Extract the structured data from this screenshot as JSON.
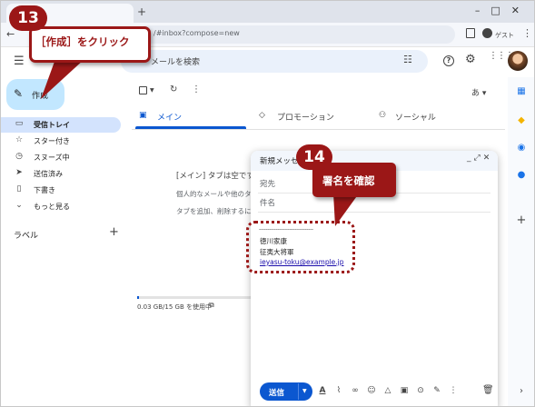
{
  "browser": {
    "tab_title": "",
    "url": "/#inbox?compose=new",
    "profile_label": "ゲスト"
  },
  "gmail": {
    "search_placeholder": "メールを検索",
    "compose_label": "作成",
    "sidebar": {
      "items": [
        {
          "label": "受信トレイ",
          "icon": "inbox-icon",
          "active": true
        },
        {
          "label": "スター付き",
          "icon": "star-icon",
          "active": false
        },
        {
          "label": "スヌーズ中",
          "icon": "clock-icon",
          "active": false
        },
        {
          "label": "送信済み",
          "icon": "send-icon",
          "active": false
        },
        {
          "label": "下書き",
          "icon": "draft-icon",
          "active": false
        },
        {
          "label": "もっと見る",
          "icon": "chevron-down-icon",
          "active": false
        }
      ],
      "labels_heading": "ラベル"
    },
    "toolbar": {
      "input_mode": "あ"
    },
    "tabs": [
      {
        "label": "メイン",
        "icon": "inbox-icon",
        "selected": true
      },
      {
        "label": "プロモーション",
        "icon": "tag-icon",
        "selected": false
      },
      {
        "label": "ソーシャル",
        "icon": "people-icon",
        "selected": false
      }
    ],
    "empty_state": {
      "line1": "[メイン] タブは空です",
      "line2": "個人的なメールや他のタ",
      "line3": "タブを追加、削除するに"
    },
    "storage": {
      "text": "0.03 GB/15 GB を使用中",
      "used_fraction": 0.002
    }
  },
  "compose": {
    "title": "新規メッセ",
    "to_label": "宛先",
    "subject_label": "件名",
    "signature_separator": "--------------------------------",
    "signature_lines": [
      "徳川家康",
      "征夷大将軍",
      "ieyasu-toku@example.jp"
    ],
    "send_label": "送信"
  },
  "annotations": {
    "step13": {
      "number": "13",
      "text": "［作成］をクリック"
    },
    "step14": {
      "number": "14",
      "text": "署名を確認"
    }
  },
  "colors": {
    "accent": "#0b57d0",
    "compose_button": "#c2e7ff",
    "active_nav": "#d3e3fd",
    "annotation": "#9b1717"
  }
}
